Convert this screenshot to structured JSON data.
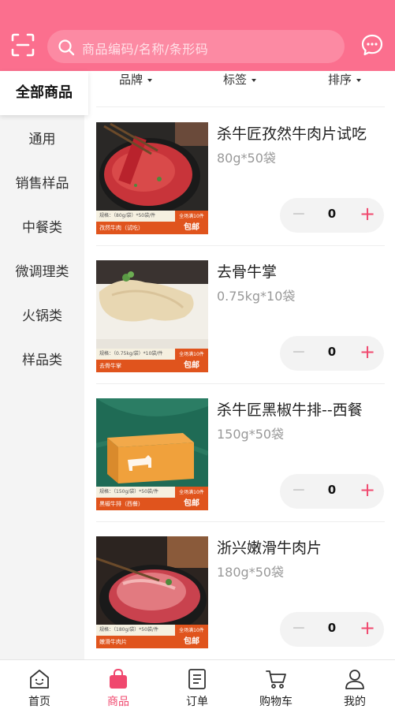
{
  "header": {
    "search_placeholder": "商品编码/名称/条形码",
    "icons": {
      "scan": "scan-icon",
      "search": "search-icon",
      "message": "chat-bubble-icon"
    }
  },
  "sidebar": {
    "items": [
      {
        "label": "全部商品",
        "active": true
      },
      {
        "label": "通用"
      },
      {
        "label": "销售样品"
      },
      {
        "label": "中餐类"
      },
      {
        "label": "微调理类"
      },
      {
        "label": "火锅类"
      },
      {
        "label": "样品类"
      }
    ]
  },
  "filters": {
    "brand": "品牌",
    "tag": "标签",
    "sort": "排序"
  },
  "products": [
    {
      "name": "杀牛匠孜然牛肉片试吃",
      "spec": "80g*50袋",
      "qty": "0",
      "image_strip": "规格：（80g/袋）*50袋/件",
      "image_title": "孜然牛肉（试吃）",
      "image_badge_small": "全场满10件",
      "image_badge_big": "包邮"
    },
    {
      "name": "去骨牛掌",
      "spec": "0.75kg*10袋",
      "qty": "0",
      "image_strip": "规格：（0.75kg/袋）*10袋/件",
      "image_title": "去骨牛掌",
      "image_badge_small": "全场满10件",
      "image_badge_big": "包邮"
    },
    {
      "name": "杀牛匠黑椒牛排--西餐",
      "spec": "150g*50袋",
      "qty": "0",
      "image_strip": "规格：（150g/袋）*50袋/件",
      "image_title": "黑椒牛排（西餐）",
      "image_badge_small": "全场满10件",
      "image_badge_big": "包邮"
    },
    {
      "name": "浙兴嫩滑牛肉片",
      "spec": "180g*50袋",
      "qty": "0",
      "image_strip": "规格：（180g/袋）*50袋/件",
      "image_title": "嫩滑牛肉片",
      "image_badge_small": "全场满10件",
      "image_badge_big": "包邮"
    }
  ],
  "stepper": {
    "minus": "−",
    "plus": "+"
  },
  "bottom_nav": [
    {
      "label": "首页",
      "icon": "home-face-icon"
    },
    {
      "label": "商品",
      "icon": "shopping-bag-icon",
      "active": true
    },
    {
      "label": "订单",
      "icon": "order-list-icon"
    },
    {
      "label": "购物车",
      "icon": "cart-icon"
    },
    {
      "label": "我的",
      "icon": "user-icon"
    }
  ],
  "colors": {
    "brand": "#fb6f8e",
    "accent": "#f0486e",
    "badge": "#e0541d"
  }
}
